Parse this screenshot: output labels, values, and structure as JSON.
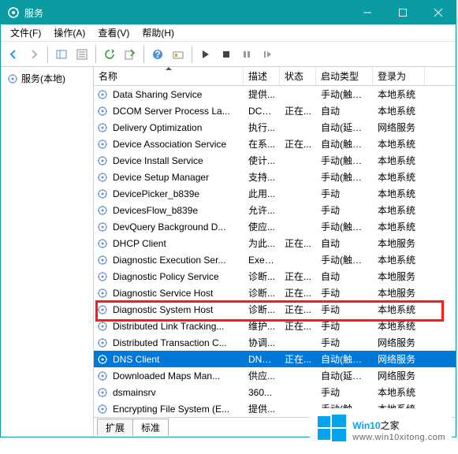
{
  "title": "服务",
  "menus": [
    "文件(F)",
    "操作(A)",
    "查看(V)",
    "帮助(H)"
  ],
  "leftNode": "服务(本地)",
  "columns": [
    "名称",
    "描述",
    "状态",
    "启动类型",
    "登录为"
  ],
  "tabs": [
    "扩展",
    "标准"
  ],
  "watermark": {
    "brand": "Win10",
    "suffix": "之家",
    "url": "www.win10xitong.com"
  },
  "rows": [
    {
      "name": "Data Sharing Service",
      "desc": "提供...",
      "status": "",
      "startup": "手动(触发...",
      "logon": "本地系统"
    },
    {
      "name": "DCOM Server Process La...",
      "desc": "DCO...",
      "status": "正在...",
      "startup": "自动",
      "logon": "本地系统"
    },
    {
      "name": "Delivery Optimization",
      "desc": "执行...",
      "status": "",
      "startup": "自动(延迟...",
      "logon": "网络服务"
    },
    {
      "name": "Device Association Service",
      "desc": "在系...",
      "status": "正在...",
      "startup": "自动(触发...",
      "logon": "本地系统"
    },
    {
      "name": "Device Install Service",
      "desc": "使计...",
      "status": "",
      "startup": "手动(触发...",
      "logon": "本地系统"
    },
    {
      "name": "Device Setup Manager",
      "desc": "支持...",
      "status": "",
      "startup": "手动(触发...",
      "logon": "本地系统"
    },
    {
      "name": "DevicePicker_b839e",
      "desc": "此用...",
      "status": "",
      "startup": "手动",
      "logon": "本地系统"
    },
    {
      "name": "DevicesFlow_b839e",
      "desc": "允许...",
      "status": "",
      "startup": "手动",
      "logon": "本地系统"
    },
    {
      "name": "DevQuery Background D...",
      "desc": "使应...",
      "status": "",
      "startup": "手动(触发...",
      "logon": "本地系统"
    },
    {
      "name": "DHCP Client",
      "desc": "为此...",
      "status": "正在...",
      "startup": "自动",
      "logon": "本地服务"
    },
    {
      "name": "Diagnostic Execution Ser...",
      "desc": "Exec...",
      "status": "",
      "startup": "手动(触发...",
      "logon": "本地系统"
    },
    {
      "name": "Diagnostic Policy Service",
      "desc": "诊断...",
      "status": "正在...",
      "startup": "自动",
      "logon": "本地服务"
    },
    {
      "name": "Diagnostic Service Host",
      "desc": "诊断...",
      "status": "正在...",
      "startup": "手动",
      "logon": "本地服务"
    },
    {
      "name": "Diagnostic System Host",
      "desc": "诊断...",
      "status": "正在...",
      "startup": "手动",
      "logon": "本地系统"
    },
    {
      "name": "Distributed Link Tracking...",
      "desc": "维护...",
      "status": "正在...",
      "startup": "手动",
      "logon": "本地系统"
    },
    {
      "name": "Distributed Transaction C...",
      "desc": "协调...",
      "status": "",
      "startup": "手动",
      "logon": "网络服务"
    },
    {
      "name": "DNS Client",
      "desc": "DNS...",
      "status": "正在...",
      "startup": "自动(触发...",
      "logon": "网络服务",
      "selected": true
    },
    {
      "name": "Downloaded Maps Man...",
      "desc": "供应...",
      "status": "",
      "startup": "自动(延迟...",
      "logon": "网络服务"
    },
    {
      "name": "dsmainsrv",
      "desc": "360...",
      "status": "",
      "startup": "手动",
      "logon": "本地系统"
    },
    {
      "name": "Encrypting File System (E...",
      "desc": "提供...",
      "status": "",
      "startup": "手动(触发...",
      "logon": "本地系统"
    }
  ]
}
